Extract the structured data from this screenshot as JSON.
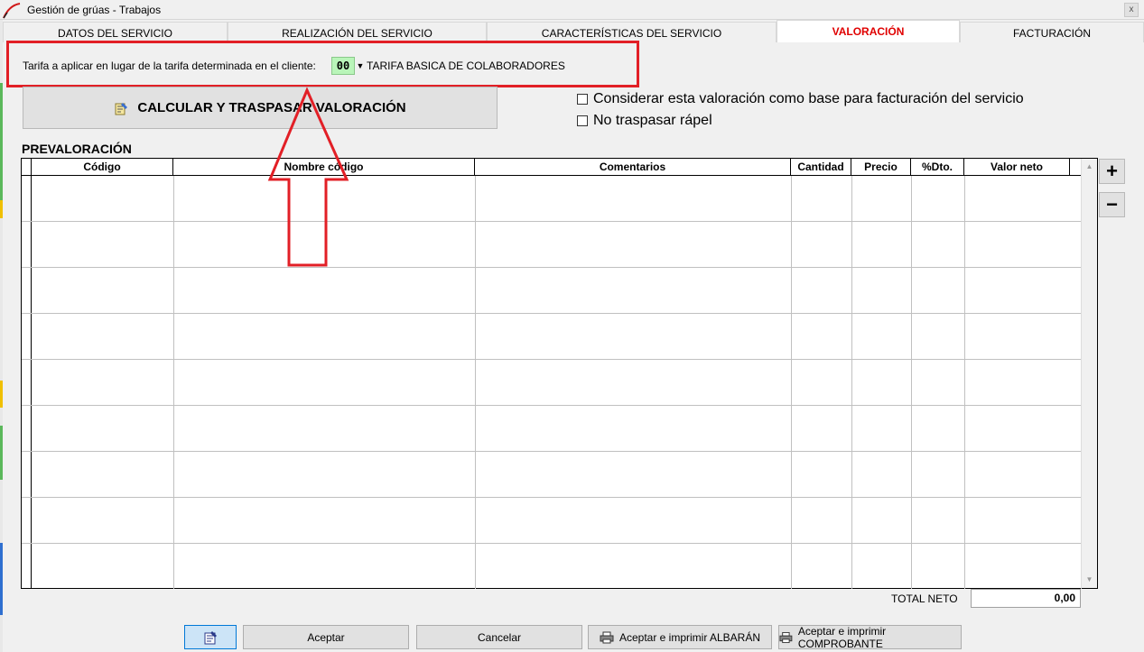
{
  "window": {
    "title": "Gestión de grúas - Trabajos",
    "close_label": "x"
  },
  "tabs": [
    {
      "label": "DATOS DEL SERVICIO"
    },
    {
      "label": "REALIZACIÓN DEL SERVICIO"
    },
    {
      "label": "CARACTERÍSTICAS DEL SERVICIO"
    },
    {
      "label": "VALORACIÓN",
      "active": true
    },
    {
      "label": "FACTURACIÓN"
    }
  ],
  "tarifa": {
    "label": "Tarifa a aplicar en lugar de la tarifa determinada en el cliente:",
    "code": "00",
    "name": "TARIFA BASICA DE COLABORADORES"
  },
  "calc_button": {
    "label": "CALCULAR Y TRASPASAR VALORACIÓN"
  },
  "options": {
    "base_facturacion": "Considerar esta valoración como base para facturación del servicio",
    "no_rapel": "No traspasar rápel"
  },
  "prevaloracion": {
    "title": "PREVALORACIÓN",
    "columns": [
      "Código",
      "Nombre código",
      "Comentarios",
      "Cantidad",
      "Precio",
      "%Dto.",
      "Valor neto"
    ],
    "rows": 9
  },
  "side_buttons": {
    "add": "+",
    "remove": "−"
  },
  "total": {
    "label": "TOTAL NETO",
    "value": "0,00"
  },
  "footer": {
    "accept": "Aceptar",
    "cancel": "Cancelar",
    "accept_albaran": "Aceptar e imprimir ALBARÁN",
    "accept_comprobante": "Aceptar e imprimir COMPROBANTE"
  },
  "colors": {
    "active_tab": "#e00000",
    "highlight": "#e21f26",
    "code_bg": "#b9f5b9"
  },
  "icons": [
    "app-logo-icon",
    "calculator-icon",
    "notepad-icon",
    "printer-icon"
  ]
}
